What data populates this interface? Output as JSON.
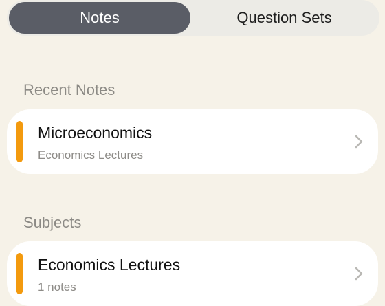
{
  "tabs": {
    "items": [
      {
        "label": "Notes",
        "selected": true
      },
      {
        "label": "Question Sets",
        "selected": false
      }
    ]
  },
  "sections": [
    {
      "header": "Recent Notes",
      "items": [
        {
          "title": "Microeconomics",
          "subtitle": "Economics Lectures",
          "accent_color": "#f39a0e",
          "trailing_icon": "chevron-right-icon"
        }
      ]
    },
    {
      "header": "Subjects",
      "items": [
        {
          "title": "Economics Lectures",
          "subtitle": "1 notes",
          "accent_color": "#f39a0e",
          "trailing_icon": "chevron-right-icon"
        }
      ]
    }
  ],
  "colors": {
    "background": "#f6f2e8",
    "segment_active": "#5a5d66",
    "accent": "#f39a0e"
  }
}
